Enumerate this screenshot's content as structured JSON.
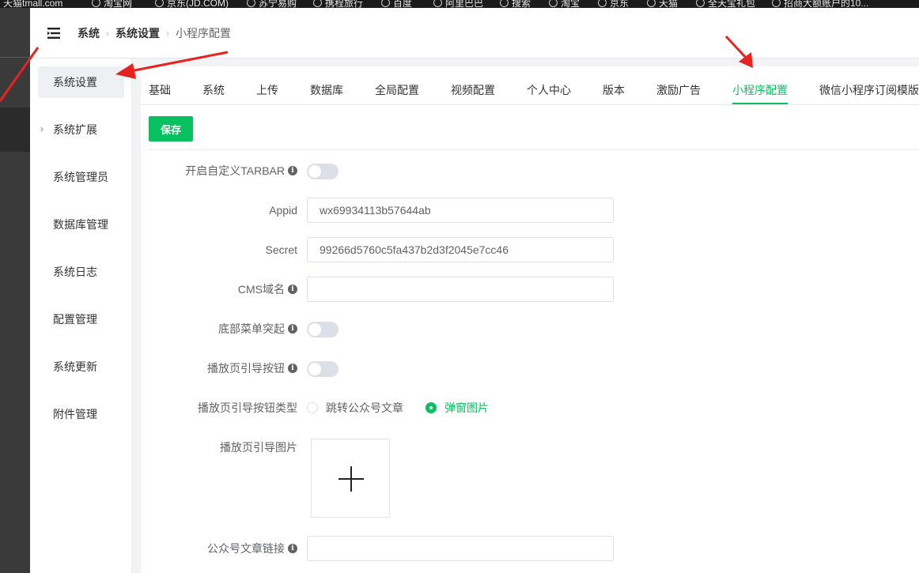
{
  "bookmarks": [
    "天猫tmall.com",
    "淘宝网",
    "京东(JD.COM)",
    "苏宁易购",
    "携程旅行",
    "百度",
    "阿里巴巴",
    "搜索",
    "淘宝",
    "京东",
    "天猫",
    "全天宝礼包",
    "招商大额账户的10..."
  ],
  "header": {
    "breadcrumb": [
      "系统",
      "系统设置",
      "小程序配置"
    ]
  },
  "sidebar": {
    "items": [
      {
        "label": "系统设置"
      },
      {
        "label": "系统扩展"
      },
      {
        "label": "系统管理员"
      },
      {
        "label": "数据库管理"
      },
      {
        "label": "系统日志"
      },
      {
        "label": "配置管理"
      },
      {
        "label": "系统更新"
      },
      {
        "label": "附件管理"
      }
    ]
  },
  "tabs": [
    {
      "label": "基础"
    },
    {
      "label": "系统"
    },
    {
      "label": "上传"
    },
    {
      "label": "数据库"
    },
    {
      "label": "全局配置"
    },
    {
      "label": "视频配置"
    },
    {
      "label": "个人中心"
    },
    {
      "label": "版本"
    },
    {
      "label": "激励广告"
    },
    {
      "label": "小程序配置"
    },
    {
      "label": "微信小程序订阅模版"
    }
  ],
  "active_tab": "小程序配置",
  "toolbar": {
    "save_label": "保存"
  },
  "form": {
    "custom_tabbar": {
      "label": "开启自定义TARBAR",
      "enabled": false
    },
    "appid": {
      "label": "Appid",
      "value": "wx69934113b57644ab"
    },
    "secret": {
      "label": "Secret",
      "value": "99266d5760c5fa437b2d3f2045e7cc46"
    },
    "cms_domain": {
      "label": "CMS域名",
      "value": ""
    },
    "bottom_menu_raise": {
      "label": "底部菜单突起",
      "enabled": false
    },
    "play_guide_button": {
      "label": "播放页引导按钮",
      "enabled": false
    },
    "guide_button_type": {
      "label": "播放页引导按钮类型",
      "options": [
        "跳转公众号文章",
        "弹窗图片"
      ],
      "selected": "弹窗图片"
    },
    "guide_image": {
      "label": "播放页引导图片"
    },
    "article_link": {
      "label": "公众号文章链接",
      "value": ""
    }
  },
  "colors": {
    "accent": "#07c160",
    "annotation_arrow": "#e8231f",
    "rail": "#3a3a3a"
  }
}
